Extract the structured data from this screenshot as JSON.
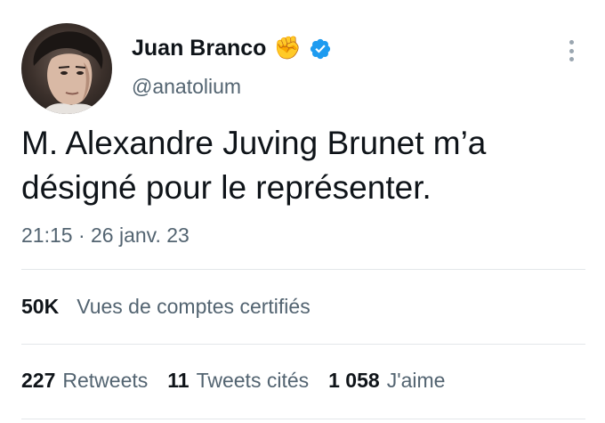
{
  "author": {
    "display_name": "Juan Branco",
    "emoji": "✊",
    "handle": "@anatolium"
  },
  "tweet": {
    "text_line1": "M. Alexandre Juving Brunet m’a",
    "text_line2": "désigné pour le représenter.",
    "time": "21:15 · 26 janv. 23"
  },
  "views": {
    "count": "50K",
    "label": "Vues de comptes certifiés"
  },
  "stats": [
    {
      "count": "227",
      "label": "Retweets"
    },
    {
      "count": "11",
      "label": "Tweets cités"
    },
    {
      "count": "1 058",
      "label": "J'aime"
    }
  ],
  "colors": {
    "verified": "#1d9bf0",
    "secondary_text": "#536471",
    "primary_text": "#0f1419",
    "divider": "#e3e7ea"
  },
  "icons": {
    "verified": "verified-badge-icon",
    "more": "more-options-icon",
    "emoji": "raised-fist-icon"
  }
}
